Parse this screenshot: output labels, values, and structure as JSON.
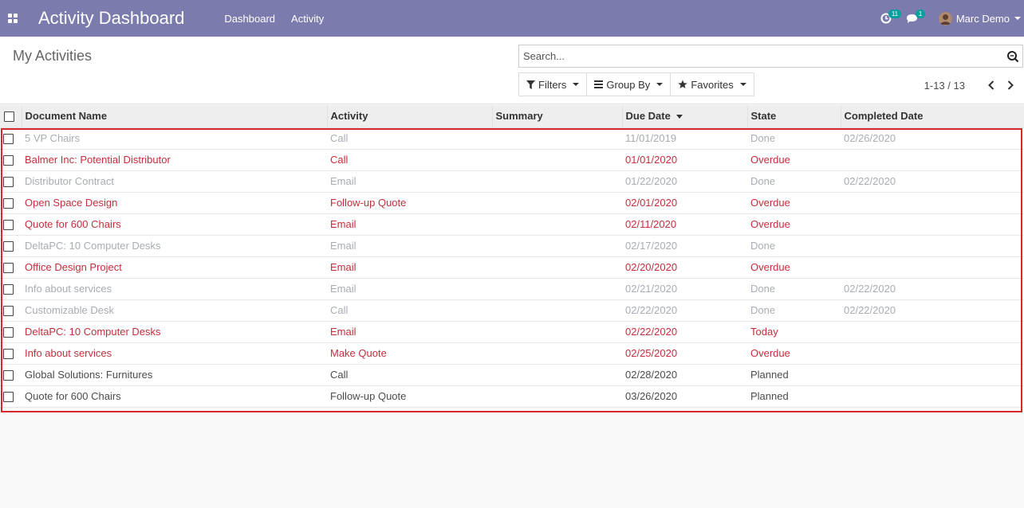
{
  "navbar": {
    "brand": "Activity Dashboard",
    "menu": [
      "Dashboard",
      "Activity"
    ],
    "activity_badge": "11",
    "messages_badge": "1",
    "user_name": "Marc Demo"
  },
  "control_panel": {
    "title": "My Activities",
    "search_placeholder": "Search...",
    "filters_label": "Filters",
    "groupby_label": "Group By",
    "favorites_label": "Favorites",
    "pager_value": "1-13 / 13"
  },
  "table": {
    "columns": [
      "Document Name",
      "Activity",
      "Summary",
      "Due Date",
      "State",
      "Completed Date"
    ],
    "sorted_column": "Due Date",
    "rows": [
      {
        "name": "5 VP Chairs",
        "activity": "Call",
        "summary": "",
        "due": "11/01/2019",
        "state": "Done",
        "completed": "02/26/2020",
        "status": "done"
      },
      {
        "name": "Balmer Inc: Potential Distributor",
        "activity": "Call",
        "summary": "",
        "due": "01/01/2020",
        "state": "Overdue",
        "completed": "",
        "status": "overdue"
      },
      {
        "name": "Distributor Contract",
        "activity": "Email",
        "summary": "",
        "due": "01/22/2020",
        "state": "Done",
        "completed": "02/22/2020",
        "status": "done"
      },
      {
        "name": "Open Space Design",
        "activity": "Follow-up Quote",
        "summary": "",
        "due": "02/01/2020",
        "state": "Overdue",
        "completed": "",
        "status": "overdue"
      },
      {
        "name": "Quote for 600 Chairs",
        "activity": "Email",
        "summary": "",
        "due": "02/11/2020",
        "state": "Overdue",
        "completed": "",
        "status": "overdue"
      },
      {
        "name": "DeltaPC: 10 Computer Desks",
        "activity": "Email",
        "summary": "",
        "due": "02/17/2020",
        "state": "Done",
        "completed": "",
        "status": "done"
      },
      {
        "name": "Office Design Project",
        "activity": "Email",
        "summary": "",
        "due": "02/20/2020",
        "state": "Overdue",
        "completed": "",
        "status": "overdue"
      },
      {
        "name": "Info about services",
        "activity": "Email",
        "summary": "",
        "due": "02/21/2020",
        "state": "Done",
        "completed": "02/22/2020",
        "status": "done"
      },
      {
        "name": "Customizable Desk",
        "activity": "Call",
        "summary": "",
        "due": "02/22/2020",
        "state": "Done",
        "completed": "02/22/2020",
        "status": "done"
      },
      {
        "name": "DeltaPC: 10 Computer Desks",
        "activity": "Email",
        "summary": "",
        "due": "02/22/2020",
        "state": "Today",
        "completed": "",
        "status": "today"
      },
      {
        "name": "Info about services",
        "activity": "Make Quote",
        "summary": "",
        "due": "02/25/2020",
        "state": "Overdue",
        "completed": "",
        "status": "overdue"
      },
      {
        "name": "Global Solutions: Furnitures",
        "activity": "Call",
        "summary": "",
        "due": "02/28/2020",
        "state": "Planned",
        "completed": "",
        "status": "planned"
      },
      {
        "name": "Quote for 600 Chairs",
        "activity": "Follow-up Quote",
        "summary": "",
        "due": "03/26/2020",
        "state": "Planned",
        "completed": "",
        "status": "planned"
      }
    ]
  },
  "colors": {
    "navbar": "#7c7bad",
    "overdue": "#c52e3d",
    "done": "#a8adb3",
    "planned": "#4c4c4c",
    "badge": "#00a09d",
    "highlight_box": "#d9272e"
  },
  "icons": [
    "apps-icon",
    "activity-clock-icon",
    "chat-icon",
    "search-icon",
    "filter-icon",
    "group-by-icon",
    "star-icon",
    "chevron-left-icon",
    "chevron-right-icon"
  ]
}
